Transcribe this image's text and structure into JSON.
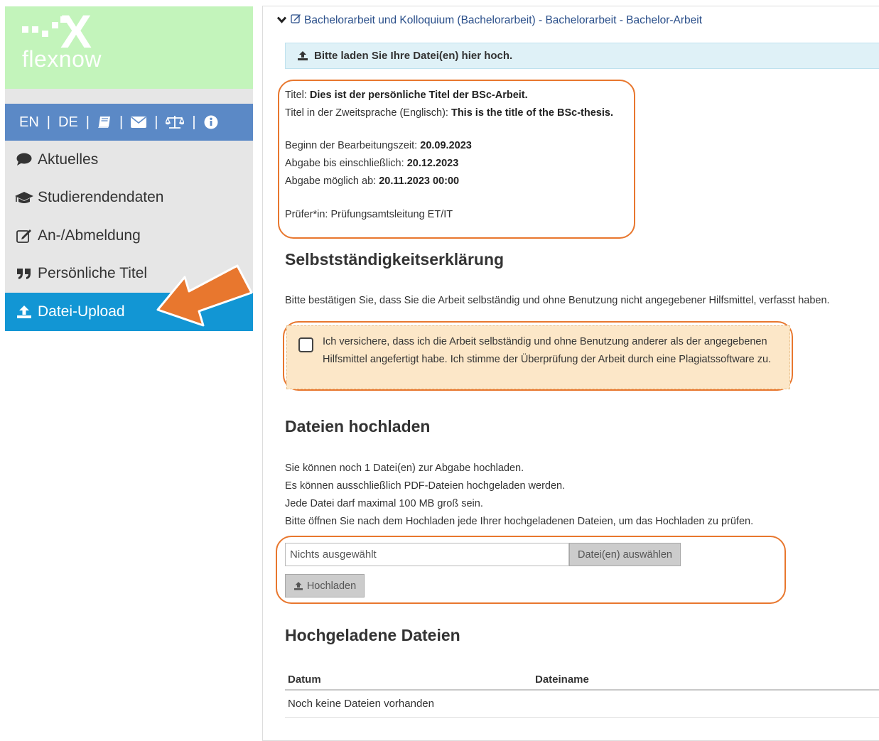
{
  "sidebar": {
    "logo_text": "flexnow",
    "lang_en": "EN",
    "lang_de": "DE",
    "sep": "|",
    "nav": [
      {
        "label": "Aktuelles",
        "icon": "comment-icon"
      },
      {
        "label": "Studierendendaten",
        "icon": "graduation-cap-icon"
      },
      {
        "label": "An-/Abmeldung",
        "icon": "edit-icon"
      },
      {
        "label": "Persönliche Titel",
        "icon": "quote-icon"
      },
      {
        "label": "Datei-Upload",
        "icon": "upload-icon",
        "active": true
      }
    ]
  },
  "main": {
    "breadcrumb": "Bachelorarbeit und Kolloquium (Bachelorarbeit) - Bachelorarbeit - Bachelor-Arbeit",
    "upload_hint": "Bitte laden Sie Ihre Datei(en) hier hoch.",
    "thesis": {
      "title_label": "Titel:",
      "title_value": "Dies ist der persönliche Titel der BSc-Arbeit.",
      "title2_label": "Titel in der Zweitsprache (Englisch):",
      "title2_value": "This is the title of the BSc-thesis.",
      "start_label": "Beginn der Bearbeitungszeit:",
      "start_value": "20.09.2023",
      "due_label": "Abgabe bis einschließlich:",
      "due_value": "20.12.2023",
      "possible_label": "Abgabe möglich ab:",
      "possible_value": "20.11.2023 00:00",
      "examiner": "Prüfer*in: Prüfungsamtsleitung ET/IT"
    },
    "declaration": {
      "heading": "Selbstständigkeitserklärung",
      "intro": "Bitte bestätigen Sie, dass Sie die Arbeit selbständig und ohne Benutzung nicht angegebener Hilfsmittel, verfasst haben.",
      "checkbox_text": "Ich versichere, dass ich die Arbeit selbständig und ohne Benutzung anderer als der angegebenen Hilfsmittel angefertigt habe. Ich stimme der Überprüfung der Arbeit durch eine Plagiatssoftware zu."
    },
    "upload": {
      "heading": "Dateien hochladen",
      "line1": "Sie können noch 1 Datei(en) zur Abgabe hochladen.",
      "line2": "Es können ausschließlich PDF-Dateien hochgeladen werden.",
      "line3": "Jede Datei darf maximal 100 MB groß sein.",
      "line4": "Bitte öffnen Sie nach dem Hochladen jede Ihrer hochgeladenen Dateien, um das Hochladen zu prüfen.",
      "file_placeholder": "Nichts ausgewählt",
      "choose_label": "Datei(en) auswählen",
      "upload_label": "Hochladen"
    },
    "uploaded": {
      "heading": "Hochgeladene Dateien",
      "col_date": "Datum",
      "col_name": "Dateiname",
      "empty": "Noch keine Dateien vorhanden"
    }
  },
  "colors": {
    "logo_bg": "#c3f4bb",
    "lang_bar": "#5b89c6",
    "active_nav": "#1296d4",
    "highlight_ring": "#e8772e",
    "consent_bg": "#fce7c8",
    "info_bg": "#dff1f7"
  }
}
